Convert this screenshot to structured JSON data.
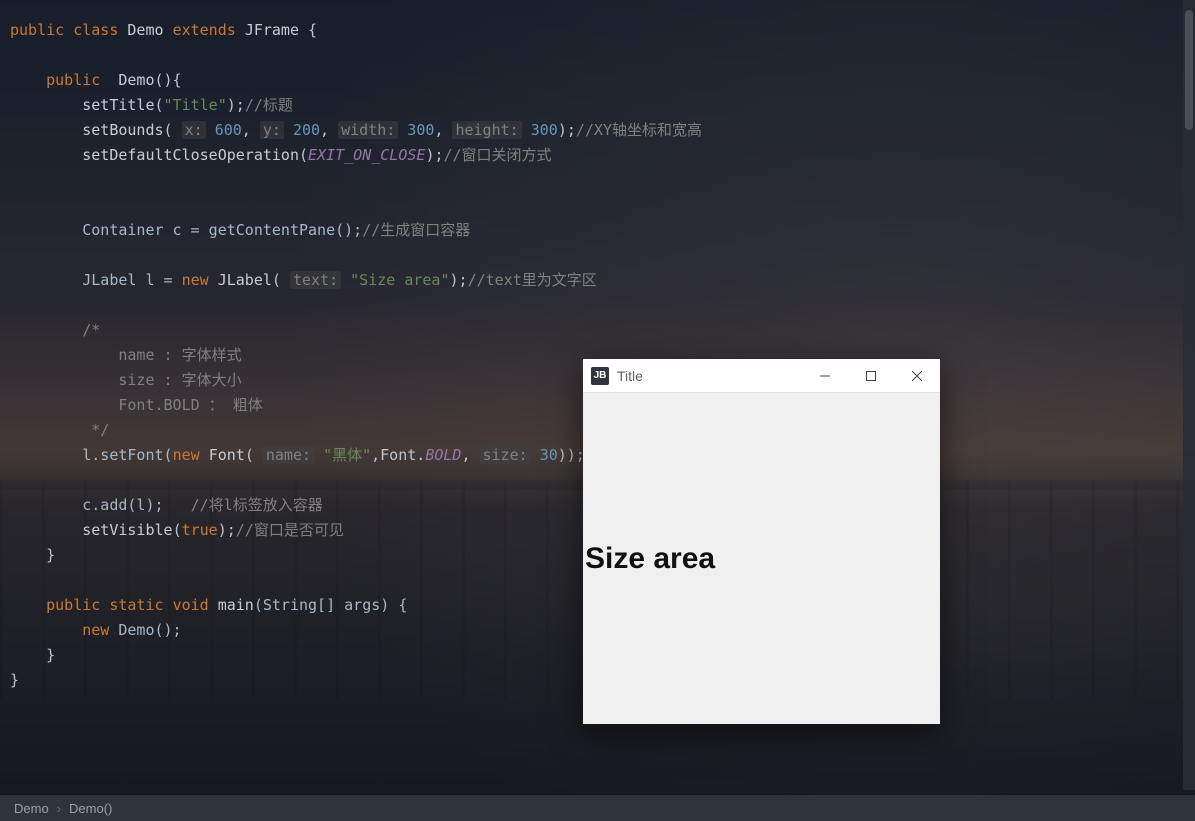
{
  "code": {
    "class_decl_kw1": "public",
    "class_decl_kw2": "class",
    "class_name": "Demo",
    "extends_kw": "extends",
    "superclass": "JFrame",
    "ctor_kw": "public",
    "ctor_name": "Demo",
    "setTitle": "setTitle",
    "title_str": "\"Title\"",
    "title_cmt": "//标题",
    "setBounds": "setBounds",
    "p_x": "x:",
    "v_x": "600",
    "p_y": "y:",
    "v_y": "200",
    "p_w": "width:",
    "v_w": "300",
    "p_h": "height:",
    "v_h": "300",
    "bounds_cmt": "//XY轴坐标和宽高",
    "setDCO": "setDefaultCloseOperation",
    "exit_const": "EXIT_ON_CLOSE",
    "dco_cmt": "//窗口关闭方式",
    "container_decl": "Container c = getContentPane();",
    "container_cmt": "//生成窗口容器",
    "jlabel_decl1": "JLabel l = ",
    "new_kw": "new",
    "jlabel_ctor": "JLabel",
    "p_text": "text:",
    "jlabel_str": "\"Size area\"",
    "jlabel_cmt": "//text里为文字区",
    "block_cmt_open": "/*",
    "block_cmt_l1": "    name : 字体样式",
    "block_cmt_l2": "    size : 字体大小",
    "block_cmt_l3": "    Font.BOLD ： 粗体",
    "block_cmt_close": " */",
    "setFont_call": "l.setFont(",
    "font_ctor": "Font",
    "p_name": "name:",
    "font_name_str": "\"黑体\"",
    "font_bold": "BOLD",
    "p_size": "size:",
    "v_size": "30",
    "add_call": "c.add(l);",
    "add_cmt": "//将l标签放入容器",
    "setVisible": "setVisible",
    "true_kw": "true",
    "visible_cmt": "//窗口是否可见",
    "main_kw_public": "public",
    "main_kw_static": "static",
    "main_kw_void": "void",
    "main_name": "main",
    "main_params": "(String[] args) {",
    "main_body": "Demo();"
  },
  "breadcrumb": {
    "item1": "Demo",
    "item2": "Demo()"
  },
  "swing": {
    "app_icon_text": "JB",
    "title": "Title",
    "label_text": "Size area"
  }
}
